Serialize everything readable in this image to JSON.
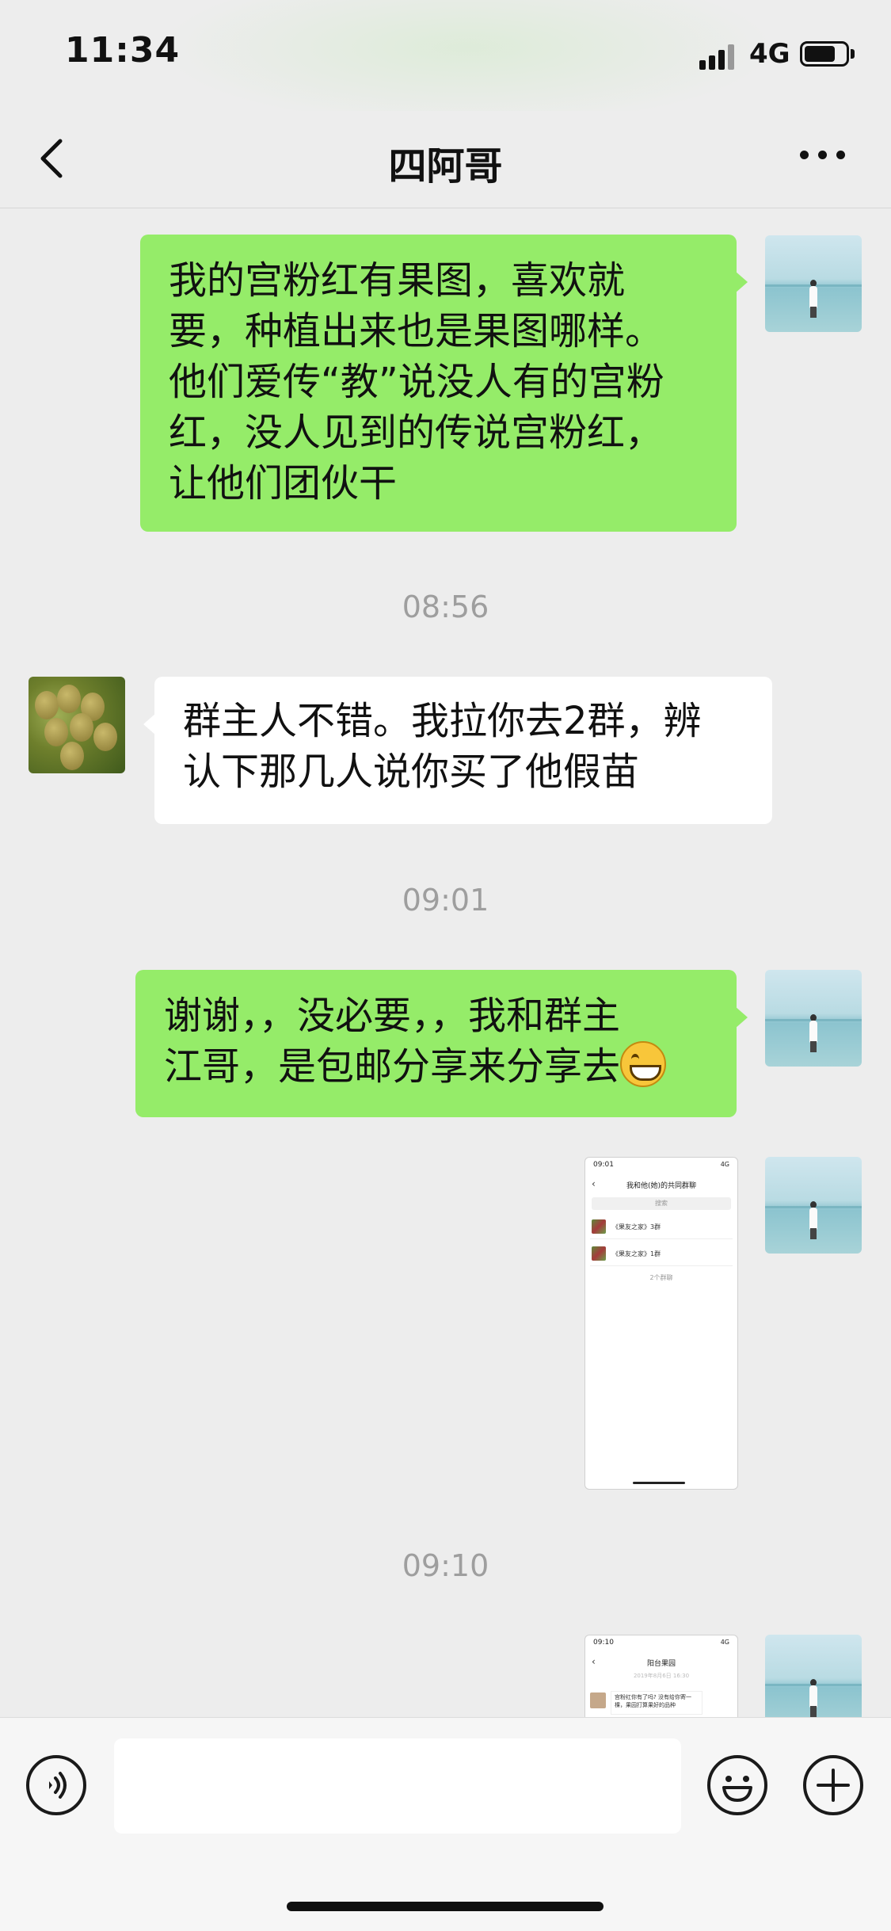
{
  "status_bar": {
    "time": "11:34",
    "network": "4G"
  },
  "header": {
    "title": "四阿哥"
  },
  "messages": {
    "m1": "我的宫粉红有果图，喜欢就\n要，种植出来也是果图哪样。\n他们爱传“教”说没人有的宫粉\n红，没人见到的传说宫粉红，\n让他们团伙干",
    "t1": "08:56",
    "m2": "群主人不错。我拉你去2群，辨\n认下那几人说你买了他假苗",
    "t2": "09:01",
    "m3": "谢谢，，没必要，，我和群主\n江哥，是包邮分享来分享去",
    "t3": "09:10"
  },
  "shot1": {
    "time": "09:01",
    "status_right": "4G",
    "title": "我和他(她)的共同群聊",
    "search": "搜索",
    "rows": [
      "《果友之家》3群",
      "《果友之家》1群"
    ],
    "count": "2个群聊"
  },
  "shot2": {
    "time": "09:10",
    "status_right": "4G",
    "title": "阳台果园",
    "date": "2019年8月6日 16:30",
    "msg": "宫粉红你有了吗? 没有给你寄一棵，果园打算果好的品种"
  },
  "icons": {
    "back": "chevron-left-icon",
    "more": "more-dots-icon",
    "voice": "voice-icon",
    "emoji": "emoji-icon",
    "plus": "plus-icon"
  },
  "colors": {
    "my_bubble": "#95ec69",
    "other_bubble": "#ffffff",
    "background": "#ededed"
  }
}
